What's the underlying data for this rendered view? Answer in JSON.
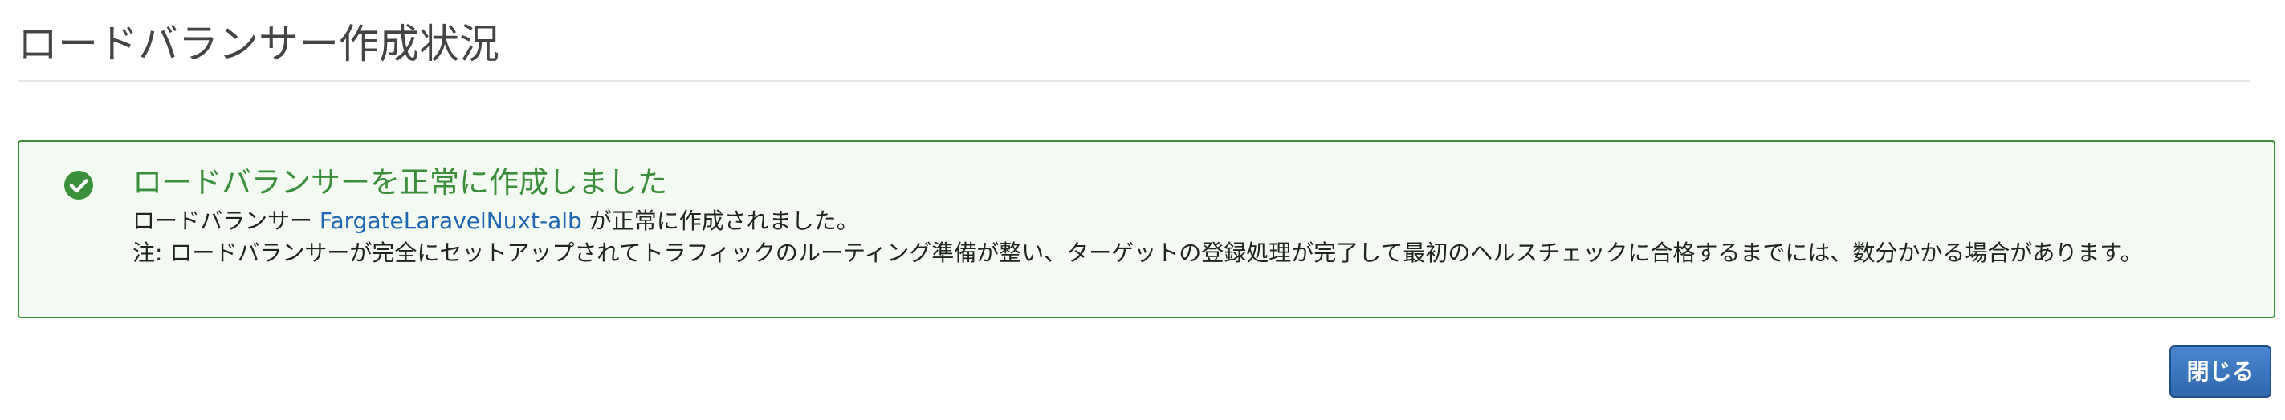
{
  "header": {
    "title": "ロードバランサー作成状況"
  },
  "alert": {
    "status": "success",
    "icon": "check-circle-icon",
    "title": "ロードバランサーを正常に作成しました",
    "message_prefix": "ロードバランサー",
    "load_balancer_name": "FargateLaravelNuxt-alb",
    "message_suffix": "が正常に作成されました。",
    "note": "注: ロードバランサーが完全にセットアップされてトラフィックのルーティング準備が整い、ターゲットの登録処理が完了して最初のヘルスチェックに合格するまでには、数分かかる場合があります。"
  },
  "footer": {
    "close_label": "閉じる"
  },
  "colors": {
    "success_text": "#3a8f3a",
    "success_border": "#3b8f3b",
    "success_background": "#f2faf2",
    "link": "#1f66b5",
    "primary_button": "#2f67ae"
  }
}
